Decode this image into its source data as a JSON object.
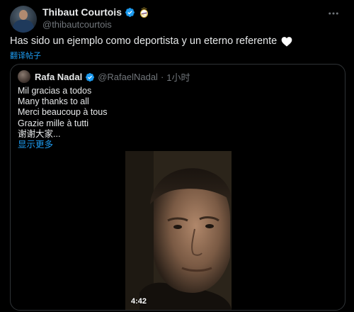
{
  "author": {
    "name": "Thibaut Courtois",
    "handle": "@thibautcourtois"
  },
  "tweet_text": "Has sido un ejemplo como deportista y un eterno referente",
  "translate_link": "翻译帖子",
  "quoted": {
    "name": "Rafa Nadal",
    "handle": "@RafaelNadal",
    "separator": "·",
    "time": "1小时",
    "lines": [
      "Mil gracias a todos",
      "Many thanks to all",
      "Merci beaucoup à tous",
      "Grazie mille à tutti",
      "谢谢大家..."
    ],
    "show_more": "显示更多",
    "video_duration": "4:42"
  },
  "colors": {
    "accent": "#1d9bf0",
    "muted": "#71767b",
    "background": "#000000"
  },
  "icons": [
    "verified-badge-icon",
    "real-madrid-crest-icon",
    "more-options-icon",
    "white-heart-icon"
  ]
}
